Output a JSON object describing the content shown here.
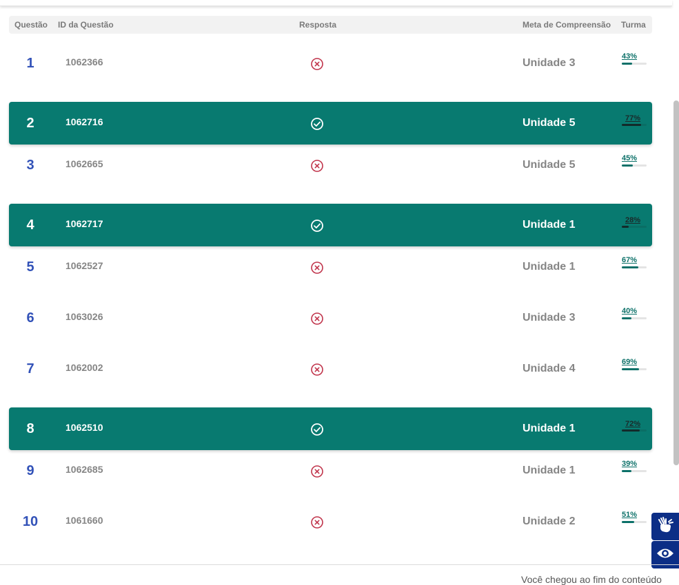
{
  "table": {
    "headers": {
      "questao": "Questão",
      "id": "ID da Questão",
      "resposta": "Resposta",
      "meta": "Meta de Compreensão",
      "turma": "Turma"
    },
    "rows": [
      {
        "numero": "1",
        "id": "1062366",
        "resposta": "incorreta",
        "meta": "Unidade 3",
        "turma_label": "43%",
        "turma_valor": 43
      },
      {
        "numero": "2",
        "id": "1062716",
        "resposta": "correta",
        "meta": "Unidade 5",
        "turma_label": "77%",
        "turma_valor": 77
      },
      {
        "numero": "3",
        "id": "1062665",
        "resposta": "incorreta",
        "meta": "Unidade 5",
        "turma_label": "45%",
        "turma_valor": 45
      },
      {
        "numero": "4",
        "id": "1062717",
        "resposta": "correta",
        "meta": "Unidade 1",
        "turma_label": "28%",
        "turma_valor": 28
      },
      {
        "numero": "5",
        "id": "1062527",
        "resposta": "incorreta",
        "meta": "Unidade 1",
        "turma_label": "67%",
        "turma_valor": 67
      },
      {
        "numero": "6",
        "id": "1063026",
        "resposta": "incorreta",
        "meta": "Unidade 3",
        "turma_label": "40%",
        "turma_valor": 40
      },
      {
        "numero": "7",
        "id": "1062002",
        "resposta": "incorreta",
        "meta": "Unidade 4",
        "turma_label": "69%",
        "turma_valor": 69
      },
      {
        "numero": "8",
        "id": "1062510",
        "resposta": "correta",
        "meta": "Unidade 1",
        "turma_label": "72%",
        "turma_valor": 72
      },
      {
        "numero": "9",
        "id": "1062685",
        "resposta": "incorreta",
        "meta": "Unidade 1",
        "turma_label": "39%",
        "turma_valor": 39
      },
      {
        "numero": "10",
        "id": "1061660",
        "resposta": "incorreta",
        "meta": "Unidade 2",
        "turma_label": "51%",
        "turma_valor": 51
      }
    ]
  },
  "icons": {
    "correct": "check-circle-icon",
    "incorrect": "x-circle-icon",
    "sign_language": "sign-language-hands-icon",
    "visibility": "eye-icon"
  },
  "footer": {
    "end_message": "Você chegou ao fim do conteúdo"
  },
  "colors": {
    "correct_row_bg": "#087a70",
    "question_number": "#3252b8",
    "incorrect_icon": "#c0334a",
    "progress": "#0b7068",
    "accessibility_bg": "#0c2e86"
  }
}
